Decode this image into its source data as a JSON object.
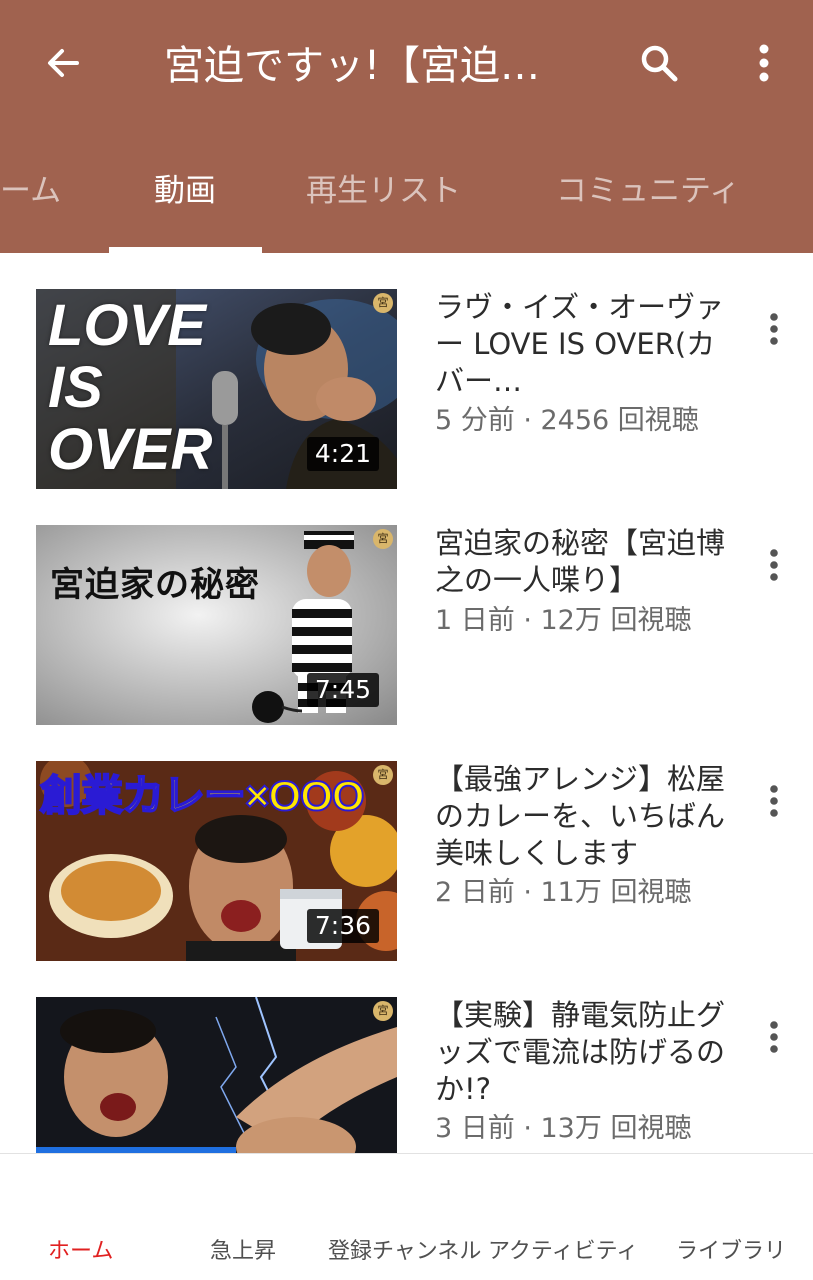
{
  "header": {
    "title": "宮迫ですッ!【宮迫…",
    "back_icon": "arrow-left-icon",
    "search_icon": "search-icon",
    "more_icon": "more-vertical-icon",
    "background_color": "#a0624f"
  },
  "tabs": [
    {
      "label": "ーム",
      "active": false
    },
    {
      "label": "動画",
      "active": true
    },
    {
      "label": "再生リスト",
      "active": false
    },
    {
      "label": "コミュニティ",
      "active": false
    }
  ],
  "videos": [
    {
      "title": "ラヴ・イズ・オーヴァー LOVE IS OVER(カバー…",
      "meta": "5 分前 · 2456 回視聴",
      "duration": "4:21",
      "thumb_text": [
        "LOVE",
        "IS",
        "OVER"
      ]
    },
    {
      "title": "宮迫家の秘密【宮迫博之の一人喋り】",
      "meta": "1 日前 · 12万 回視聴",
      "duration": "7:45",
      "thumb_text": [
        "宮迫家の秘密"
      ]
    },
    {
      "title": "【最強アレンジ】松屋のカレーを、いちばん美味しくします",
      "meta": "2 日前 · 11万 回視聴",
      "duration": "7:36",
      "thumb_text": [
        "創業カレー×OOO"
      ]
    },
    {
      "title": "【実験】静電気防止グッズで電流は防げるのか!?",
      "meta": "3 日前 · 13万 回視聴",
      "duration": "",
      "thumb_text": []
    }
  ],
  "channel_badge": "宮",
  "bottom_nav": [
    {
      "label": "ホーム",
      "active": true
    },
    {
      "label": "急上昇",
      "active": false
    },
    {
      "label": "登録チャンネル",
      "active": false
    },
    {
      "label": "アクティビティ",
      "active": false
    },
    {
      "label": "ライブラリ",
      "active": false
    }
  ],
  "colors": {
    "accent_active_nav": "#e02020",
    "title_text": "#2c2c2c",
    "meta_text": "#6b6b6b"
  }
}
